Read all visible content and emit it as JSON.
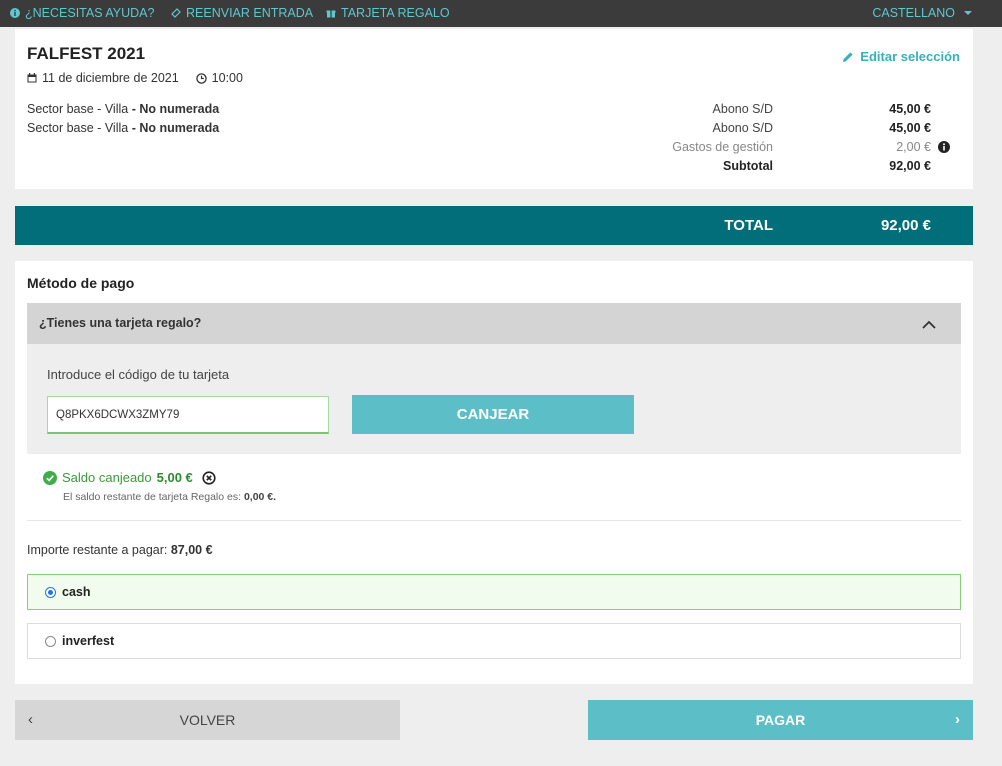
{
  "topbar": {
    "help": "¿NECESITAS AYUDA?",
    "resend": "REENVIAR ENTRADA",
    "gift_card": "TARJETA REGALO",
    "language": "CASTELLANO"
  },
  "event": {
    "title": "FALFEST 2021",
    "date": "11 de diciembre de 2021",
    "time": "10:00",
    "edit_label": "Editar selección"
  },
  "tickets": [
    {
      "sector": "Sector base - Villa",
      "sep": " - ",
      "type": "No numerada",
      "label": "Abono S/D",
      "price": "45,00 €"
    },
    {
      "sector": "Sector base - Villa",
      "sep": " - ",
      "type": "No numerada",
      "label": "Abono S/D",
      "price": "45,00 €"
    }
  ],
  "fees": {
    "label": "Gastos de gestión",
    "amount": "2,00 €"
  },
  "subtotal": {
    "label": "Subtotal",
    "amount": "92,00 €"
  },
  "total": {
    "label": "TOTAL",
    "amount": "92,00 €"
  },
  "payment": {
    "title": "Método de pago",
    "gift_question": "¿Tienes una tarjeta regalo?",
    "code_prompt": "Introduce el código de tu tarjeta",
    "code_value": "Q8PKX6DCWX3ZMY79",
    "redeem_label": "CANJEAR",
    "redeemed_prefix": "Saldo canjeado",
    "redeemed_amount": "5,00 €",
    "remaining_balance_prefix": "El saldo restante de tarjeta Regalo es:",
    "remaining_balance_amount": "0,00 €.",
    "remaining_to_pay_prefix": "Importe restante a pagar:",
    "remaining_to_pay_amount": "87,00 €",
    "options": [
      {
        "label": "cash",
        "selected": true
      },
      {
        "label": "inverfest",
        "selected": false
      }
    ]
  },
  "nav": {
    "back_label": "VOLVER",
    "pay_label": "PAGAR"
  },
  "colors": {
    "accent": "#5cbec6",
    "total_bar": "#026e79",
    "success": "#3a9a3a",
    "topbar": "#3b3b3b"
  }
}
